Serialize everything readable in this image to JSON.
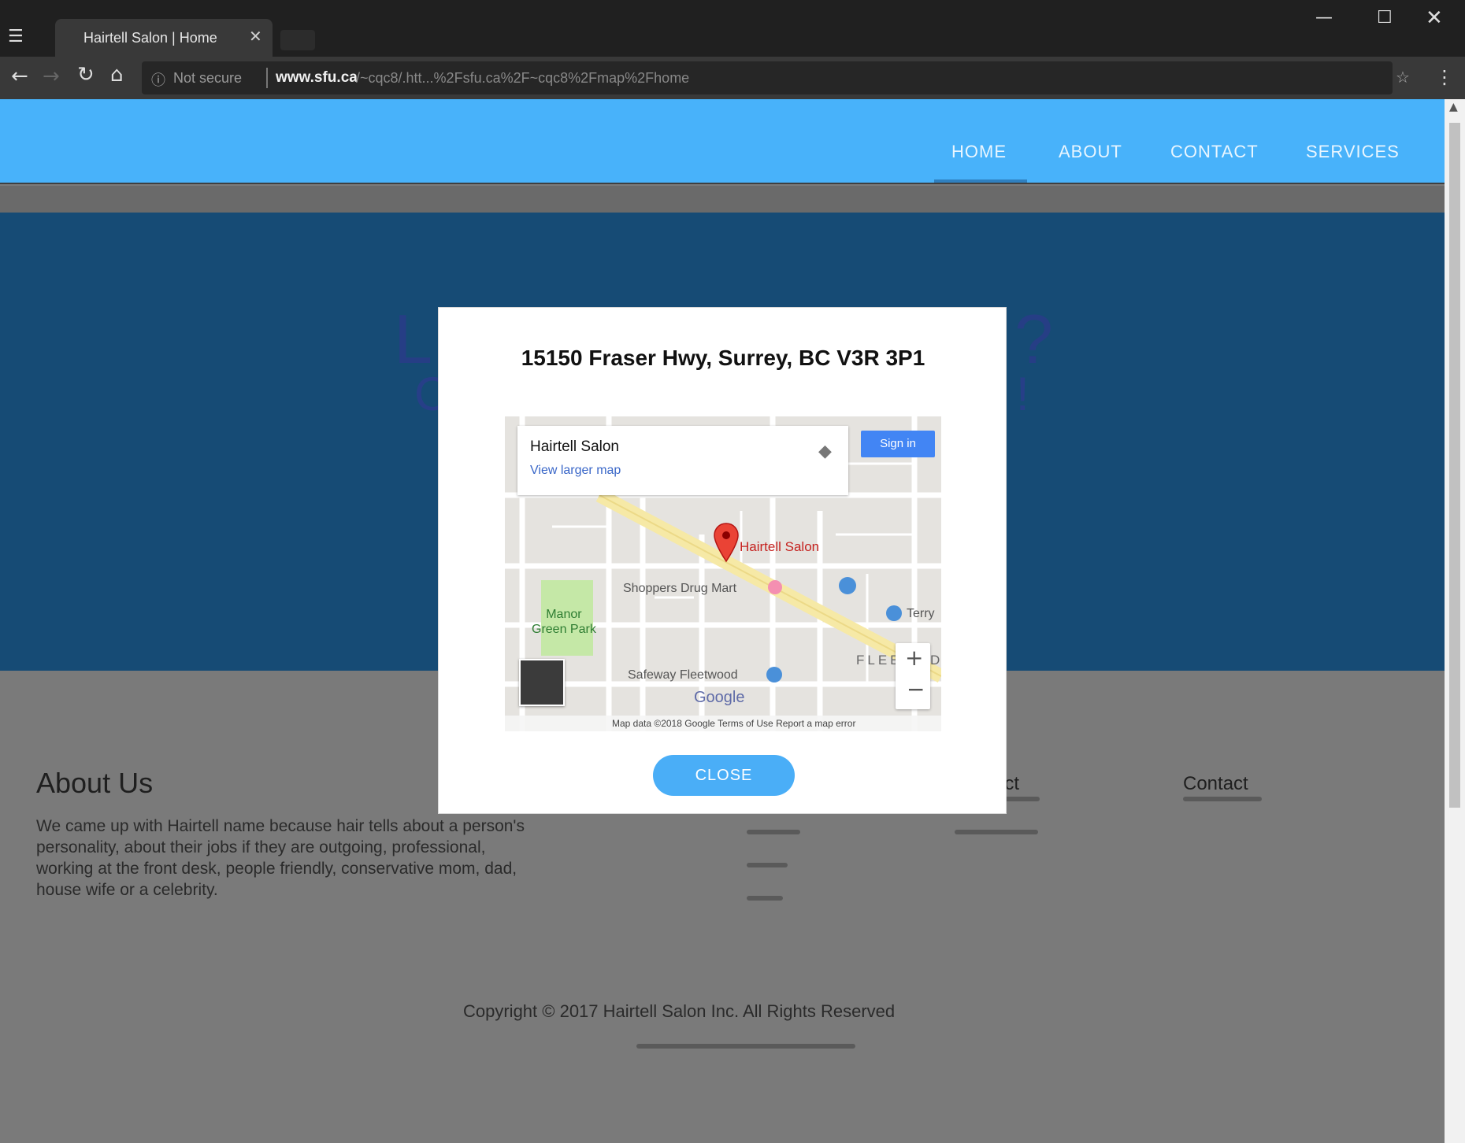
{
  "browser": {
    "tab_title": "Hairtell Salon | Home",
    "tab_close": "✕",
    "secure_label": "Not secure",
    "url_domain": "www.sfu.ca",
    "url_path": "/~cqc8/.htt...%2Fsfu.ca%2F~cqc8%2Fmap%2Fhome",
    "window_controls": {
      "minimize": "—",
      "maximize": "☐",
      "close": "✕"
    }
  },
  "nav": {
    "items": [
      {
        "label": "HOME"
      },
      {
        "label": "ABOUT"
      },
      {
        "label": "CONTACT"
      },
      {
        "label": "SERVICES"
      }
    ],
    "active": "HOME"
  },
  "hero": {
    "line1_start": "L",
    "line1_end": "?",
    "line2_start": "C",
    "line2_end": "!"
  },
  "footer": {
    "about_heading": "About Us",
    "about_text": "We came up with Hairtell name because hair tells about a person's personality, about their jobs if they are outgoing, professional, working at the front desk, people friendly, conservative mom, dad, house wife or a celebrity.",
    "connect_heading": "ect",
    "contact_heading": "Contact",
    "copyright": "Copyright © 2017 Hairtell Salon Inc. All Rights Reserved"
  },
  "modal": {
    "title": "15150 Fraser Hwy, Surrey, BC V3R 3P1",
    "close_label": "CLOSE",
    "map": {
      "card_title": "Hairtell Salon",
      "card_link": "View larger map",
      "sign_in": "Sign in",
      "pin_label": "Hairtell Salon",
      "poi_shoppers": "Shoppers Drug Mart",
      "poi_park": "Manor\nGreen Park",
      "poi_safeway": "Safeway Fleetwood",
      "poi_terry": "Terry",
      "area_label": "FLEE",
      "area_label_end": "D",
      "google_logo": "Google",
      "attribution": "Map data ©2018 Google   Terms of Use   Report a map error",
      "zoom_in": "+",
      "zoom_out": "−"
    }
  },
  "colors": {
    "nav_bg": "#48b2fa",
    "hero_bg": "#164b75",
    "close_button": "#4aaef7",
    "pin": "#ea4335"
  }
}
